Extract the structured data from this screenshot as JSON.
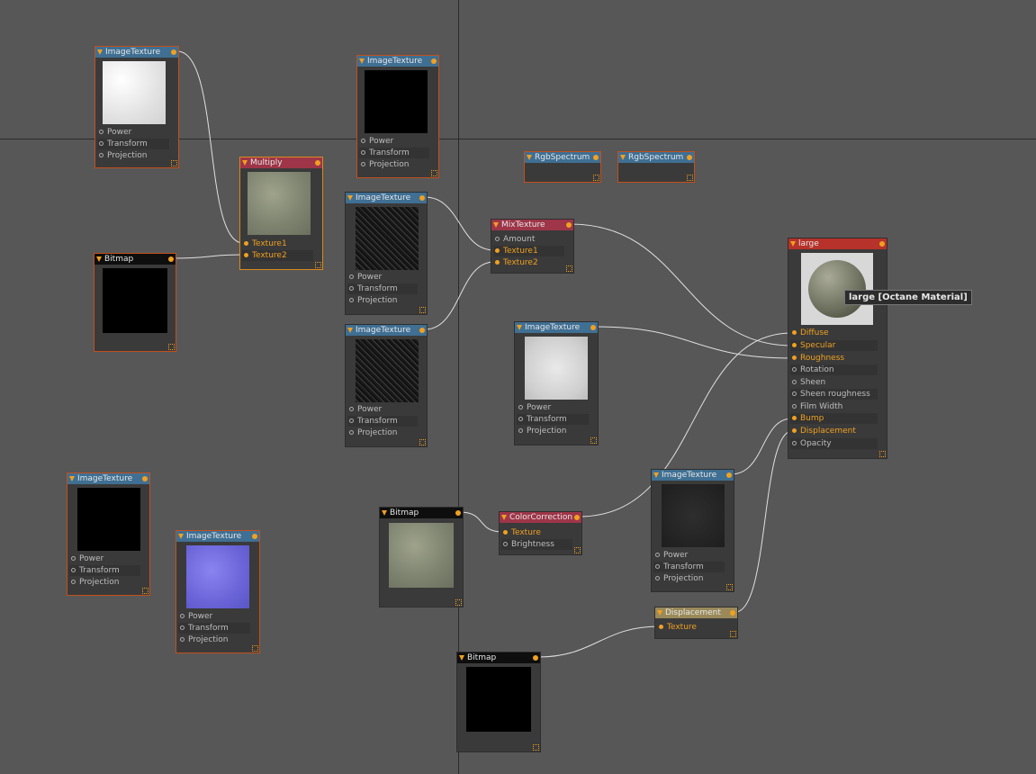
{
  "nodes": {
    "imgtex_a": {
      "title": "ImageTexture",
      "rows": [
        "Power",
        "Transform",
        "Projection"
      ]
    },
    "imgtex_b": {
      "title": "ImageTexture",
      "rows": [
        "Power",
        "Transform",
        "Projection"
      ]
    },
    "multiply": {
      "title": "Multiply",
      "rows": [
        "Texture1",
        "Texture2"
      ]
    },
    "bitmap_a": {
      "title": "Bitmap"
    },
    "imgtex_c": {
      "title": "ImageTexture",
      "rows": [
        "Power",
        "Transform",
        "Projection"
      ]
    },
    "imgtex_d": {
      "title": "ImageTexture",
      "rows": [
        "Power",
        "Transform",
        "Projection"
      ]
    },
    "rgb_a": {
      "title": "RgbSpectrum"
    },
    "rgb_b": {
      "title": "RgbSpectrum"
    },
    "mixtex": {
      "title": "MixTexture",
      "rows": [
        "Amount",
        "Texture1",
        "Texture2"
      ]
    },
    "imgtex_e": {
      "title": "ImageTexture",
      "rows": [
        "Power",
        "Transform",
        "Projection"
      ]
    },
    "large": {
      "title": "large",
      "rows": [
        "Diffuse",
        "Specular",
        "Roughness",
        "Rotation",
        "Sheen",
        "Sheen roughness",
        "Film Width",
        "Bump",
        "Displacement",
        "Opacity"
      ]
    },
    "imgtex_f": {
      "title": "ImageTexture",
      "rows": [
        "Power",
        "Transform",
        "Projection"
      ]
    },
    "imgtex_g": {
      "title": "ImageTexture",
      "rows": [
        "Power",
        "Transform",
        "Projection"
      ]
    },
    "bitmap_b": {
      "title": "Bitmap"
    },
    "colorcorr": {
      "title": "ColorCorrection",
      "rows": [
        "Texture",
        "Brightness"
      ]
    },
    "imgtex_h": {
      "title": "ImageTexture",
      "rows": [
        "Power",
        "Transform",
        "Projection"
      ]
    },
    "displacement": {
      "title": "Displacement",
      "rows": [
        "Texture"
      ]
    },
    "bitmap_c": {
      "title": "Bitmap"
    }
  },
  "tooltip": "large [Octane Material]",
  "colors": {
    "background": "#575757",
    "wire": "#e0e0e0",
    "pin_active": "#f0a020",
    "header_texture": "#3f6f93",
    "header_bitmap": "#0e0e0e",
    "header_operator": "#9e3548",
    "header_material": "#b6322a",
    "header_displacement": "#9a8a5a",
    "selection_border": "#c2501c"
  }
}
